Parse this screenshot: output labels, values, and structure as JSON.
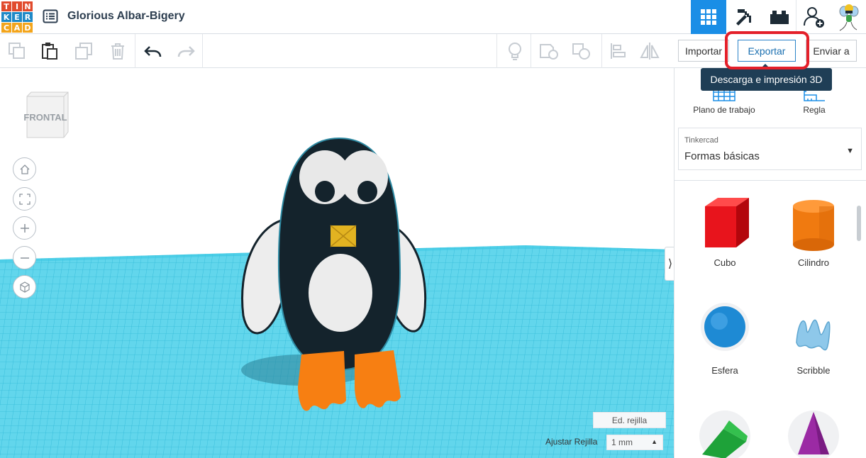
{
  "app": {
    "logo_letters": [
      "T",
      "I",
      "N",
      "K",
      "E",
      "R",
      "C",
      "A",
      "D"
    ],
    "logo_colors": [
      "#e14b2d",
      "#e14b2d",
      "#e14b2d",
      "#1f89c7",
      "#1f89c7",
      "#1f89c7",
      "#f3a51c",
      "#f3a51c",
      "#f3a51c"
    ],
    "design_title": "Glorious Albar-Bigery"
  },
  "top_nav": {
    "items": [
      {
        "icon": "3d-design-grid-icon",
        "active": true
      },
      {
        "icon": "codeblocks-pickaxe-icon",
        "active": false
      },
      {
        "icon": "bricks-icon",
        "active": false
      },
      {
        "icon": "add-user-icon",
        "active": false
      },
      {
        "icon": "avatar-icon",
        "active": false
      }
    ]
  },
  "toolbar": {
    "icons": [
      "copy-icon",
      "paste-icon",
      "duplicate-icon",
      "delete-icon",
      "undo-icon",
      "redo-icon",
      "lightbulb-icon",
      "shape-note-icon",
      "group-icon",
      "align-icon",
      "mirror-icon"
    ]
  },
  "actions": {
    "import_label": "Importar",
    "export_label": "Exportar",
    "send_label": "Enviar a"
  },
  "tooltip": {
    "text": "Descarga e impresión 3D"
  },
  "viewport": {
    "view_cube_label": "FRONTAL",
    "controls": [
      "home-icon",
      "fit-view-icon",
      "zoom-in-icon",
      "zoom-out-icon",
      "perspective-icon"
    ],
    "grid_edit_label": "Ed. rejilla",
    "snap_label": "Ajustar Rejilla",
    "snap_value": "1 mm",
    "grid_color": "#4fd0e8"
  },
  "right_panel": {
    "workplane_label": "Plano de trabajo",
    "ruler_label": "Regla",
    "library_source": "Tinkercad",
    "library_name": "Formas básicas",
    "shapes": [
      {
        "label": "Cubo",
        "color": "#e8141c"
      },
      {
        "label": "Cilindro",
        "color": "#f07a10"
      },
      {
        "label": "Esfera",
        "color": "#1e8ad4"
      },
      {
        "label": "Scribble",
        "color": "#8ec8ea"
      },
      {
        "label": "",
        "color": "#1ea239"
      },
      {
        "label": "",
        "color": "#9b2aa4"
      }
    ]
  },
  "colors": {
    "accent": "#1a8ee6",
    "highlight": "#e4202a",
    "tooltip_bg": "#1f3e56",
    "penguin_body": "#14232c",
    "penguin_feet": "#f77f12",
    "penguin_beak": "#e2b321"
  }
}
